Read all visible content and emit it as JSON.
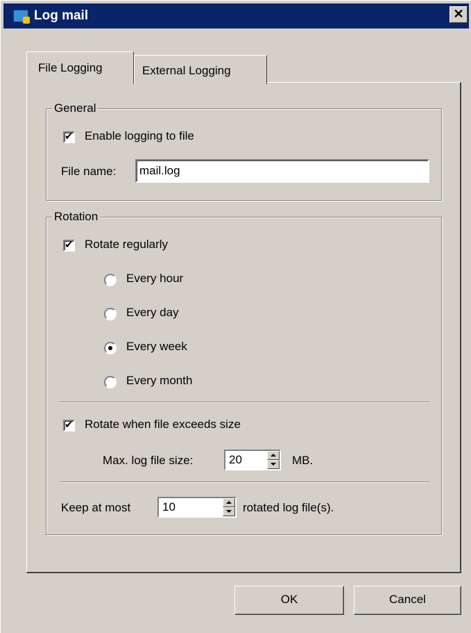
{
  "window": {
    "title": "Log mail",
    "close_symbol": "✕"
  },
  "tabs": [
    {
      "label": "File Logging",
      "active": true
    },
    {
      "label": "External Logging",
      "active": false
    }
  ],
  "general": {
    "title": "General",
    "enable_logging_label": "Enable logging to file",
    "enable_logging_checked": true,
    "file_name_label": "File name:",
    "file_name_value": "mail.log"
  },
  "rotation": {
    "title": "Rotation",
    "rotate_regularly_label": "Rotate regularly",
    "rotate_regularly_checked": true,
    "options": [
      "Every hour",
      "Every day",
      "Every week",
      "Every month"
    ],
    "selected_option": "Every week",
    "rotate_size_label": "Rotate when file exceeds size",
    "rotate_size_checked": true,
    "max_size_label": "Max. log file size:",
    "max_size_value": "20",
    "max_size_unit": "MB.",
    "keep_label": "Keep at most",
    "keep_value": "10",
    "keep_suffix": "rotated log file(s)."
  },
  "buttons": {
    "ok": "OK",
    "cancel": "Cancel"
  },
  "colors": {
    "titlebar": "#0a246a",
    "face": "#d4d0c8"
  },
  "icons": {
    "app": "log-mail-app-icon",
    "close": "close-icon"
  }
}
